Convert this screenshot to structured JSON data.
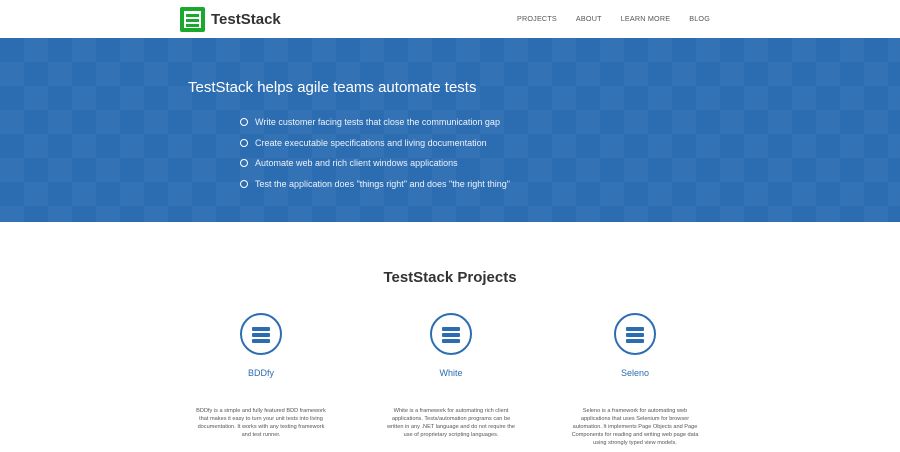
{
  "brand": {
    "name": "TestStack"
  },
  "nav": {
    "items": [
      "PROJECTS",
      "ABOUT",
      "LEARN MORE",
      "BLOG"
    ]
  },
  "hero": {
    "title": "TestStack helps agile teams automate tests",
    "bullets": [
      "Write customer facing tests that close the communication gap",
      "Create executable specifications and living documentation",
      "Automate web and rich client windows applications",
      "Test the application does \"things right\" and does \"the right thing\""
    ]
  },
  "projects": {
    "title": "TestStack Projects",
    "items": [
      {
        "name": "BDDfy",
        "icon": "menu-icon",
        "description": "BDDfy is a simple and fully featured BDD framework that makes it easy to turn your unit tests into living documentation. It works with any testing framework and test runner."
      },
      {
        "name": "White",
        "icon": "menu-icon",
        "description": "White is a framework for automating rich client applications. Tests/automation programs can be written in any .NET language and do not require the use of proprietary scripting languages."
      },
      {
        "name": "Seleno",
        "icon": "menu-icon",
        "description": "Seleno is a framework for automating web applications that uses Selenium for browser automation. It implements Page Objects and Page Components for reading and writing web page data using strongly typed view models."
      }
    ]
  },
  "colors": {
    "accent": "#2c6db2",
    "logo": "#1aa82e"
  }
}
